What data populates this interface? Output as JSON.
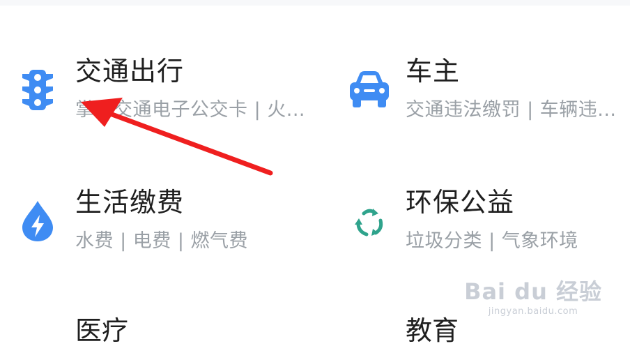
{
  "services": [
    {
      "title": "交通出行",
      "subtitle": "掌上交通电子公交卡 | 火..."
    },
    {
      "title": "车主",
      "subtitle": "交通违法缴罚 | 车辆违..."
    },
    {
      "title": "生活缴费",
      "subtitle": "水费 | 电费 | 燃气费"
    },
    {
      "title": "环保公益",
      "subtitle": "垃圾分类 | 气象环境"
    },
    {
      "title": "医疗"
    },
    {
      "title": "教育"
    }
  ],
  "watermark": {
    "brand": "Bai du 经验",
    "url": "jingyan.baidu.com"
  },
  "colors": {
    "icon_blue": "#3f8cf3",
    "recycle_green": "#2fa38c",
    "arrow_red": "#ef1f1f"
  }
}
